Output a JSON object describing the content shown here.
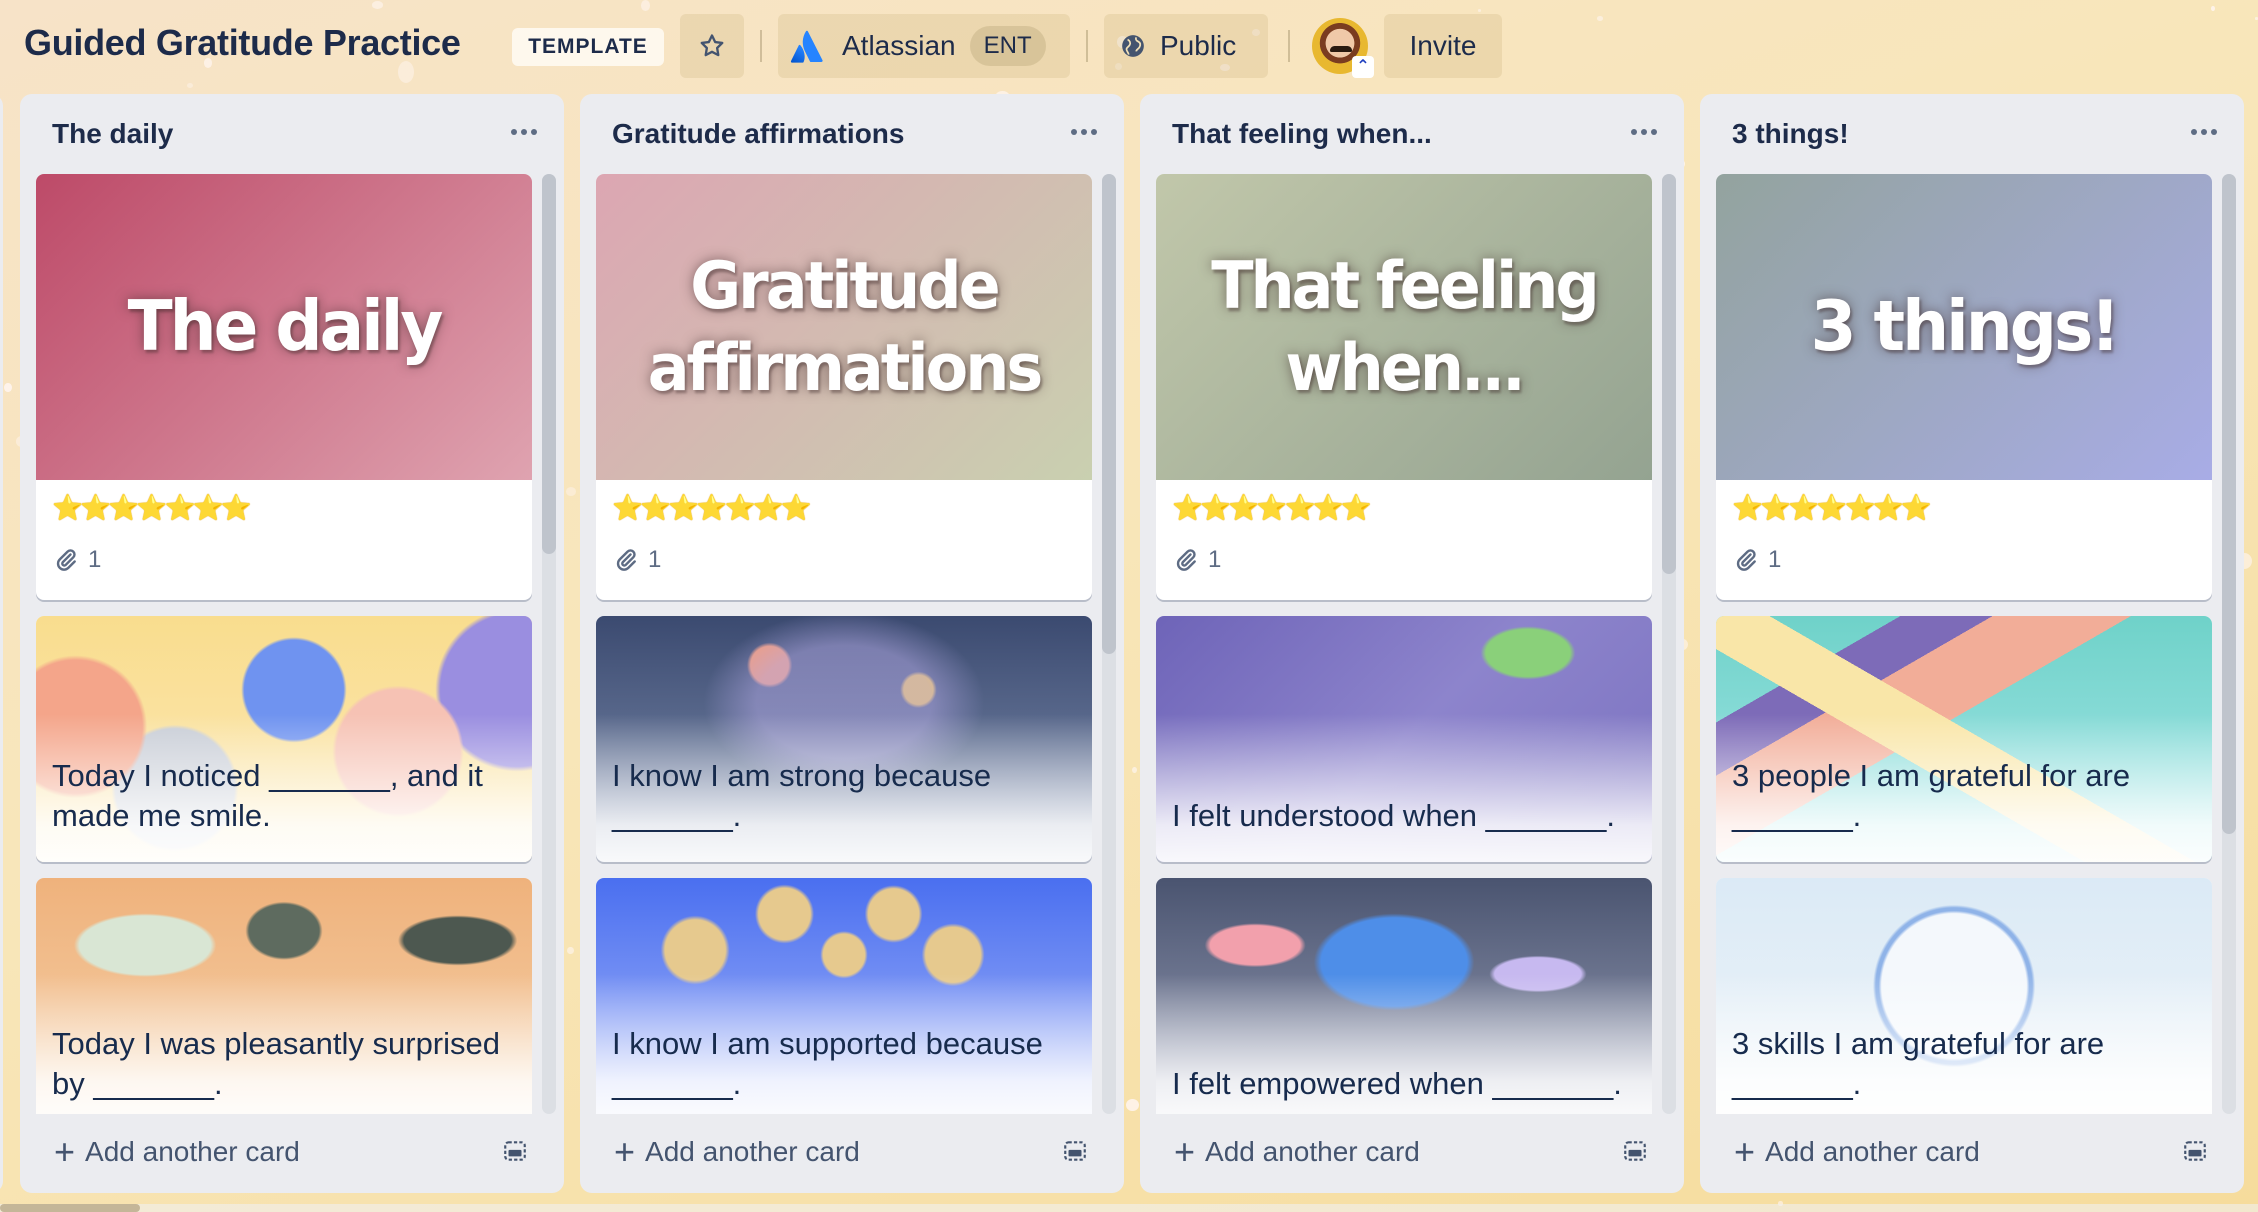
{
  "board": {
    "title": "Guided Gratitude Practice",
    "template_badge": "TEMPLATE",
    "workspace_name": "Atlassian",
    "workspace_tier": "ENT",
    "visibility": "Public",
    "invite_label": "Invite",
    "icons": {
      "star": "star-outline-icon",
      "workspace": "atlassian-logo",
      "visibility": "globe-icon",
      "admin": "double-chevron-up-icon"
    }
  },
  "colors": {
    "text_primary": "#172b4d",
    "list_bg": "#ebecf0",
    "board_bg": "#f8e6b9",
    "atlassian_blue": "#2684ff"
  },
  "lists": [
    {
      "title": "The daily",
      "cover_card": {
        "cover_text": "The daily",
        "stars": "⭐⭐⭐⭐⭐⭐⭐",
        "star_count": 7,
        "attachments": "1",
        "gradient": [
          "#bd4a68",
          "#dfa3b0"
        ]
      },
      "cards": [
        {
          "title": "Today I noticed _______, and it made me smile.",
          "theme": "ribbons"
        },
        {
          "title": "Today I was pleasantly surprised by _______.",
          "theme": "oysters"
        }
      ],
      "add_card_label": "Add another card"
    },
    {
      "title": "Gratitude affirmations",
      "cover_card": {
        "cover_text": "Gratitude affirmations",
        "stars": "⭐⭐⭐⭐⭐⭐⭐",
        "star_count": 7,
        "attachments": "1",
        "gradient": [
          "#dca6b2",
          "#c9d0b0"
        ]
      },
      "cards": [
        {
          "title": "I know I am strong because _______.",
          "theme": "swirl"
        },
        {
          "title": "I know I am supported because _______.",
          "theme": "molecule"
        }
      ],
      "add_card_label": "Add another card"
    },
    {
      "title": "That feeling when...",
      "cover_card": {
        "cover_text": "That feeling when...",
        "stars": "⭐⭐⭐⭐⭐⭐⭐",
        "star_count": 7,
        "attachments": "1",
        "gradient": [
          "#c1c7aa",
          "#94a391"
        ]
      },
      "cards": [
        {
          "title": "I felt understood when _______.",
          "theme": "maze"
        },
        {
          "title": "I felt empowered when _______.",
          "theme": "lightbulb"
        }
      ],
      "add_card_label": "Add another card"
    },
    {
      "title": "3 things!",
      "cover_card": {
        "cover_text": "3 things!",
        "stars": "⭐⭐⭐⭐⭐⭐⭐",
        "star_count": 7,
        "attachments": "1",
        "gradient": [
          "#93a39e",
          "#a8ace6"
        ]
      },
      "cards": [
        {
          "title": "3 people I am grateful for are _______.",
          "theme": "hands"
        },
        {
          "title": "3 skills I am grateful for are _______.",
          "theme": "clock"
        }
      ],
      "add_card_label": "Add another card"
    }
  ]
}
